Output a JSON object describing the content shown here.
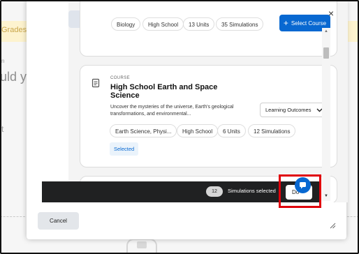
{
  "background": {
    "banner_text": "Grades",
    "small_text": "n",
    "heading_text": "uld y",
    "t_text": "t"
  },
  "dialog": {
    "close_label": "×",
    "top_buttons": {
      "back_icon": "arrow-left-icon",
      "dropdown_icon": "chevron-down-icon"
    },
    "cards": [
      {
        "pills": [
          "Biology",
          "High School",
          "13 Units",
          "35 Simulations"
        ],
        "select_label": "Select Course"
      },
      {
        "kicker": "COURSE",
        "title": "High School Earth and Space Science",
        "description": "Uncover the mysteries of the universe, Earth's geological transformations, and environmental...",
        "dropdown_label": "Learning Outcomes",
        "pills": [
          "Earth Science, Physi...",
          "High School",
          "6 Units",
          "12 Simulations"
        ],
        "selected_label": "Selected"
      }
    ],
    "bottom_bar": {
      "count": "12",
      "label": "Simulations selected",
      "done_label": "Do"
    },
    "cancel_label": "Cancel"
  },
  "colors": {
    "accent": "#0868d1",
    "bottom_bar": "#202122",
    "highlight": "#e0000b"
  }
}
